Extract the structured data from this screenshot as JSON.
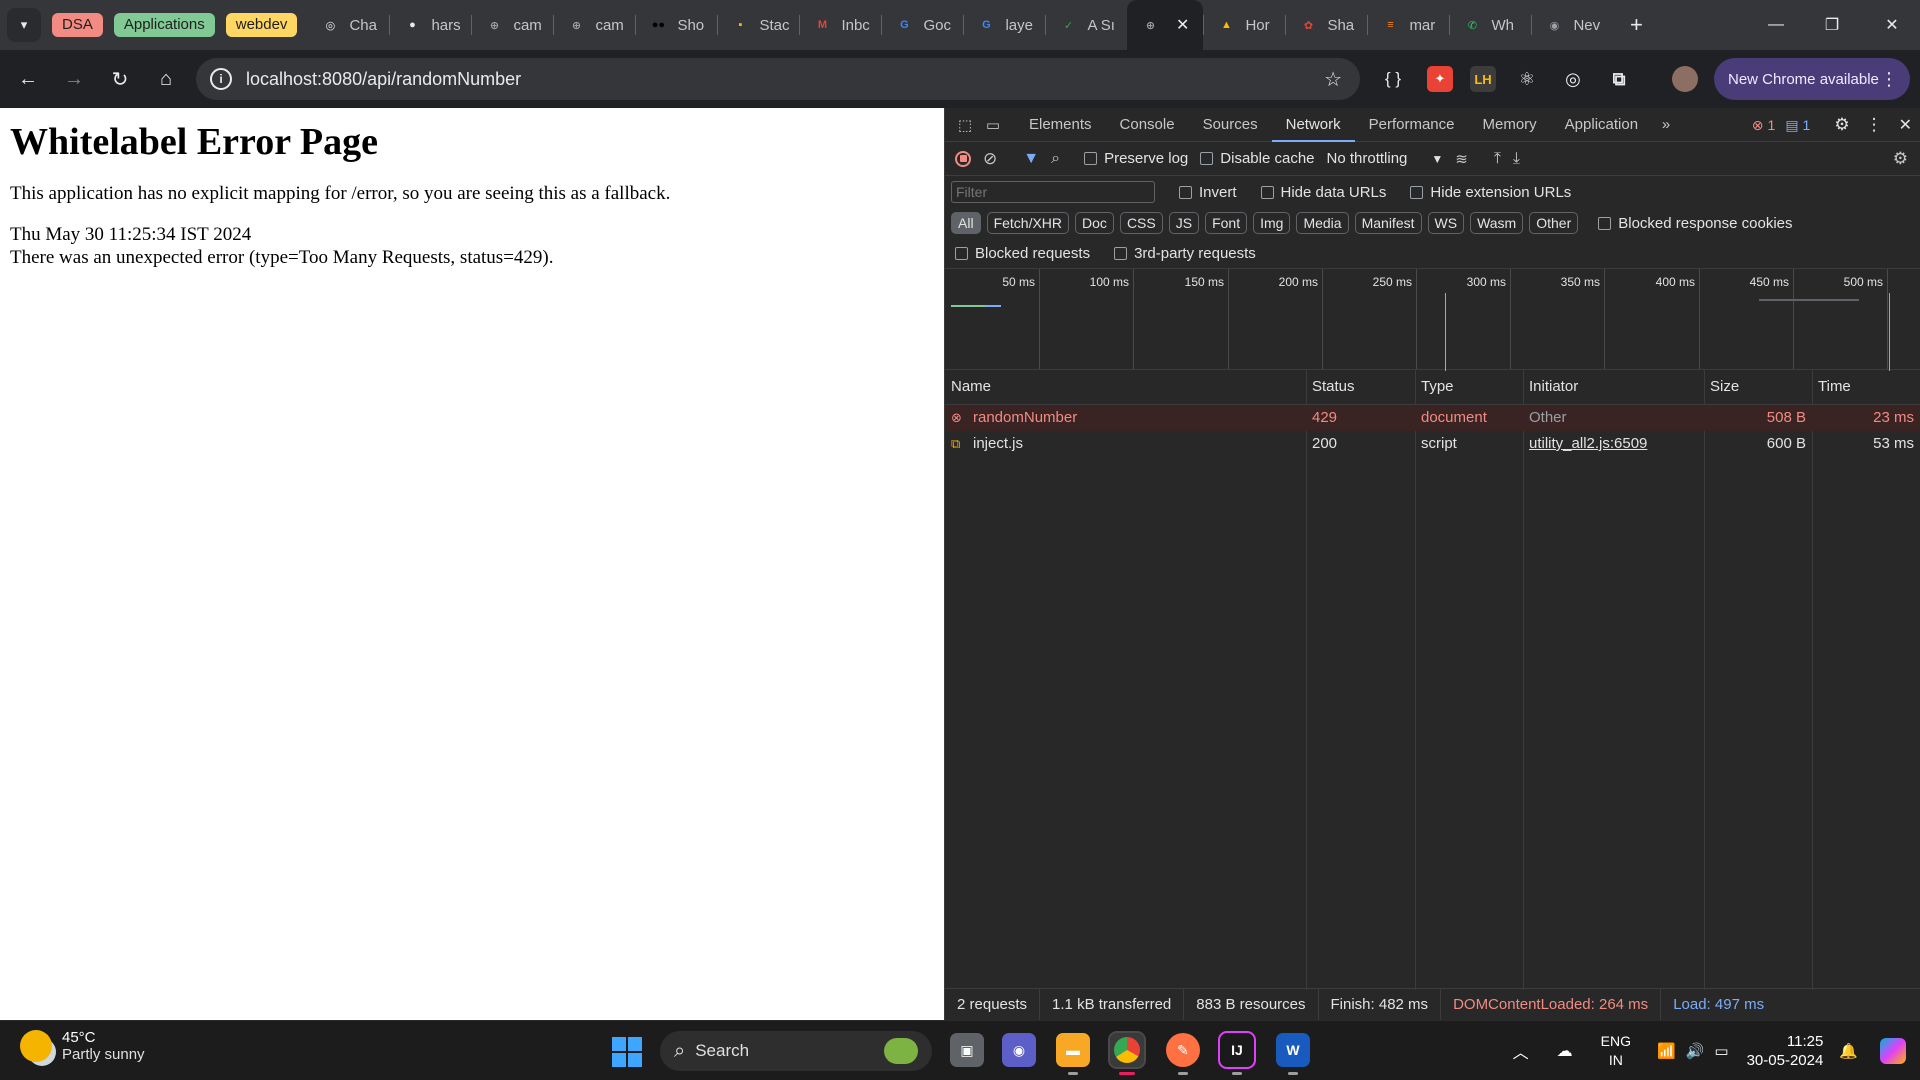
{
  "browser": {
    "tab_search_icon": "chevron-down-icon",
    "groups": [
      {
        "label": "DSA",
        "color": "#f28b82"
      },
      {
        "label": "Applications",
        "color": "#81c995"
      },
      {
        "label": "webdev",
        "color": "#fdd663"
      }
    ],
    "tabs": [
      {
        "title": "Cha",
        "icon": "chatgpt-icon",
        "color": "#e8eaed",
        "glyph": "◎"
      },
      {
        "title": "hars",
        "icon": "github-icon",
        "color": "#e8eaed",
        "glyph": "●"
      },
      {
        "title": "cam",
        "icon": "globe-icon",
        "color": "#9aa0a6",
        "glyph": "⊕"
      },
      {
        "title": "cam",
        "icon": "globe-icon",
        "color": "#9aa0a6",
        "glyph": "⊕"
      },
      {
        "title": "Sho",
        "icon": "medium-icon",
        "color": "#000000",
        "glyph": "●●"
      },
      {
        "title": "Stac",
        "icon": "keep-icon",
        "color": "#fbbc04",
        "glyph": "▪"
      },
      {
        "title": "Inbc",
        "icon": "gmail-icon",
        "color": "#ea4335",
        "glyph": "M"
      },
      {
        "title": "Goc",
        "icon": "google-icon",
        "color": "#4285f4",
        "glyph": "G"
      },
      {
        "title": "laye",
        "icon": "google-icon",
        "color": "#4285f4",
        "glyph": "G"
      },
      {
        "title": "A Sı",
        "icon": "sheets-icon",
        "color": "#34a853",
        "glyph": "✓"
      },
      {
        "title": "",
        "icon": "globe-icon",
        "color": "#9aa0a6",
        "glyph": "⊕",
        "active": true
      },
      {
        "title": "Hor",
        "icon": "drive-icon",
        "color": "#fbbc04",
        "glyph": "▲"
      },
      {
        "title": "Sha",
        "icon": "photos-icon",
        "color": "#ea4335",
        "glyph": "✿"
      },
      {
        "title": "mar",
        "icon": "stackoverflow-icon",
        "color": "#f48024",
        "glyph": "≡"
      },
      {
        "title": "Wh",
        "icon": "whatsapp-icon",
        "color": "#25d366",
        "glyph": "✆"
      },
      {
        "title": "Nev",
        "icon": "chrome-icon",
        "color": "#9aa0a6",
        "glyph": "◉"
      }
    ],
    "url": "localhost:8080/api/randomNumber",
    "new_chrome_label": "New Chrome available"
  },
  "page": {
    "heading": "Whitelabel Error Page",
    "message": "This application has no explicit mapping for /error, so you are seeing this as a fallback.",
    "timestamp": "Thu May 30 11:25:34 IST 2024",
    "error": "There was an unexpected error (type=Too Many Requests, status=429)."
  },
  "devtools": {
    "tabs": [
      "Elements",
      "Console",
      "Sources",
      "Network",
      "Performance",
      "Memory",
      "Application"
    ],
    "active_tab": "Network",
    "error_count": "1",
    "message_count": "1",
    "preserve_log": "Preserve log",
    "disable_cache": "Disable cache",
    "throttling": "No throttling",
    "filter_placeholder": "Filter",
    "invert": "Invert",
    "hide_data_urls": "Hide data URLs",
    "hide_extension_urls": "Hide extension URLs",
    "type_filters": [
      "All",
      "Fetch/XHR",
      "Doc",
      "CSS",
      "JS",
      "Font",
      "Img",
      "Media",
      "Manifest",
      "WS",
      "Wasm",
      "Other"
    ],
    "blocked_response_cookies": "Blocked response cookies",
    "blocked_requests": "Blocked requests",
    "third_party_requests": "3rd-party requests",
    "timeline_ticks": [
      "50 ms",
      "100 ms",
      "150 ms",
      "200 ms",
      "250 ms",
      "300 ms",
      "350 ms",
      "400 ms",
      "450 ms",
      "500 ms"
    ],
    "columns": [
      "Name",
      "Status",
      "Type",
      "Initiator",
      "Size",
      "Time"
    ],
    "requests": [
      {
        "name": "randomNumber",
        "status": "429",
        "type": "document",
        "initiator": "Other",
        "size": "508 B",
        "time": "23 ms",
        "error": true
      },
      {
        "name": "inject.js",
        "status": "200",
        "type": "script",
        "initiator": "utility_all2.js:6509",
        "size": "600 B",
        "time": "53 ms",
        "error": false
      }
    ],
    "summary": {
      "requests": "2 requests",
      "transferred": "1.1 kB transferred",
      "resources": "883 B resources",
      "finish": "Finish: 482 ms",
      "dom_loaded": "DOMContentLoaded: 264 ms",
      "load": "Load: 497 ms"
    }
  },
  "taskbar": {
    "temperature": "45°C",
    "weather": "Partly sunny",
    "search_label": "Search",
    "language": "ENG",
    "region": "IN",
    "time": "11:25",
    "date": "30-05-2024"
  }
}
